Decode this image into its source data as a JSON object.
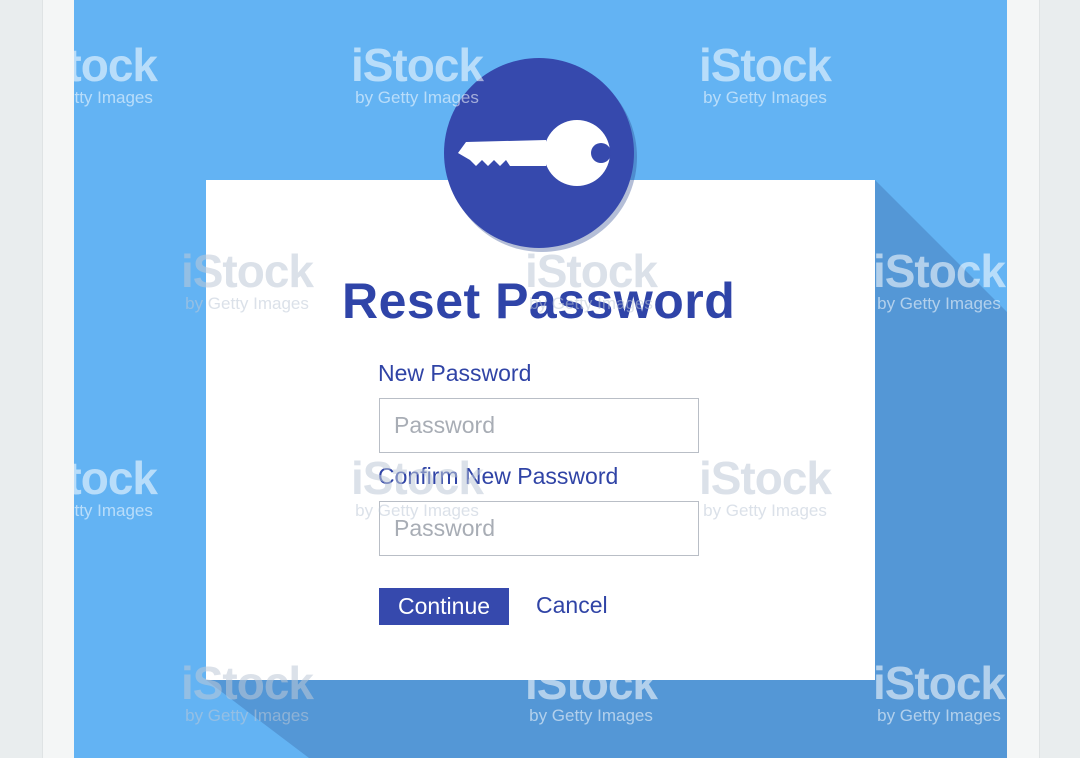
{
  "dialog": {
    "title": "Reset Password",
    "new_password_label": "New Password",
    "new_password_placeholder": "Password",
    "confirm_password_label": "Confirm New Password",
    "confirm_password_placeholder": "Password",
    "continue_label": "Continue",
    "cancel_label": "Cancel",
    "icon": "key-icon"
  },
  "watermark": {
    "logo": "iStock",
    "sub": "by Getty Images"
  },
  "colors": {
    "background": "#63b3f3",
    "accent": "#3649ad",
    "text": "#3044a6",
    "card": "#ffffff"
  }
}
